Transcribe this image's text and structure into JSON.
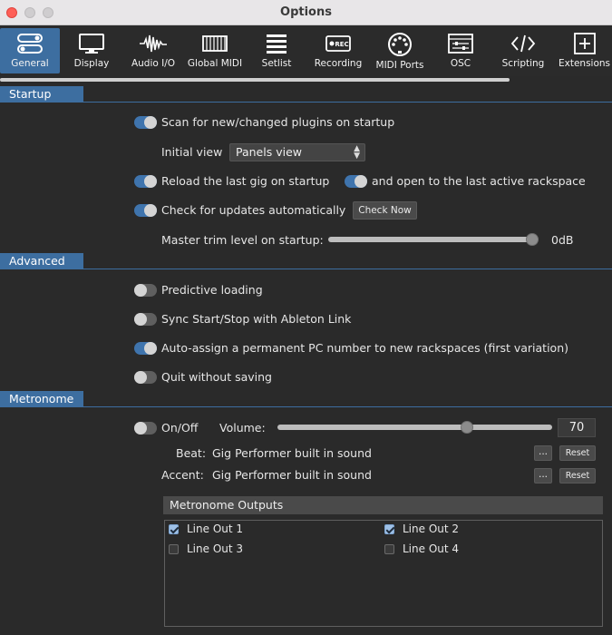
{
  "window": {
    "title": "Options"
  },
  "toolbar": {
    "items": [
      {
        "label": "General",
        "icon": "sliders-icon"
      },
      {
        "label": "Display",
        "icon": "monitor-icon"
      },
      {
        "label": "Audio I/O",
        "icon": "waveform-icon"
      },
      {
        "label": "Global MIDI",
        "icon": "keyboard-icon"
      },
      {
        "label": "Setlist",
        "icon": "list-icon"
      },
      {
        "label": "Recording",
        "icon": "rec-icon",
        "badge": "REC"
      },
      {
        "label": "MIDI Ports",
        "icon": "midi-port-icon"
      },
      {
        "label": "OSC",
        "icon": "osc-icon"
      },
      {
        "label": "Scripting",
        "icon": "code-icon"
      },
      {
        "label": "Extensions",
        "icon": "plus-box-icon"
      }
    ],
    "active": "General"
  },
  "startup": {
    "section_label": "Startup",
    "scan_plugins": {
      "label": "Scan for new/changed plugins on startup",
      "on": true
    },
    "initial_view": {
      "label": "Initial view",
      "value": "Panels view"
    },
    "reload_gig": {
      "label": "Reload the last gig on startup",
      "on": true
    },
    "open_last_rackspace": {
      "label": "and open to the last active rackspace",
      "on": true
    },
    "check_updates": {
      "label": "Check for updates automatically",
      "on": true,
      "button": "Check Now"
    },
    "master_trim": {
      "label": "Master trim level on startup:",
      "value": "0dB",
      "level": 1.0
    }
  },
  "advanced": {
    "section_label": "Advanced",
    "predictive_loading": {
      "label": "Predictive loading",
      "on": false
    },
    "sync_ableton": {
      "label": "Sync Start/Stop with Ableton Link",
      "on": false
    },
    "auto_assign_pc": {
      "label": "Auto-assign a permanent PC number to new rackspaces (first variation)",
      "on": true
    },
    "quit_without_saving": {
      "label": "Quit without saving",
      "on": false
    }
  },
  "metronome": {
    "section_label": "Metronome",
    "onoff": {
      "label": "On/Off",
      "on": false
    },
    "volume": {
      "label": "Volume:",
      "value": "70",
      "level": 0.7
    },
    "beat": {
      "label": "Beat:",
      "value": "Gig Performer built in sound",
      "browse": "...",
      "reset": "Reset"
    },
    "accent": {
      "label": "Accent:",
      "value": "Gig Performer built in sound",
      "browse": "...",
      "reset": "Reset"
    },
    "outputs": {
      "header": "Metronome Outputs",
      "items": [
        {
          "label": "Line Out 1",
          "checked": true
        },
        {
          "label": "Line Out 2",
          "checked": true
        },
        {
          "label": "Line Out 3",
          "checked": false
        },
        {
          "label": "Line Out 4",
          "checked": false
        }
      ]
    }
  },
  "colors": {
    "accent": "#3d6ea0",
    "toggle_on": "#3f74ad",
    "background": "#2a2a2a"
  }
}
